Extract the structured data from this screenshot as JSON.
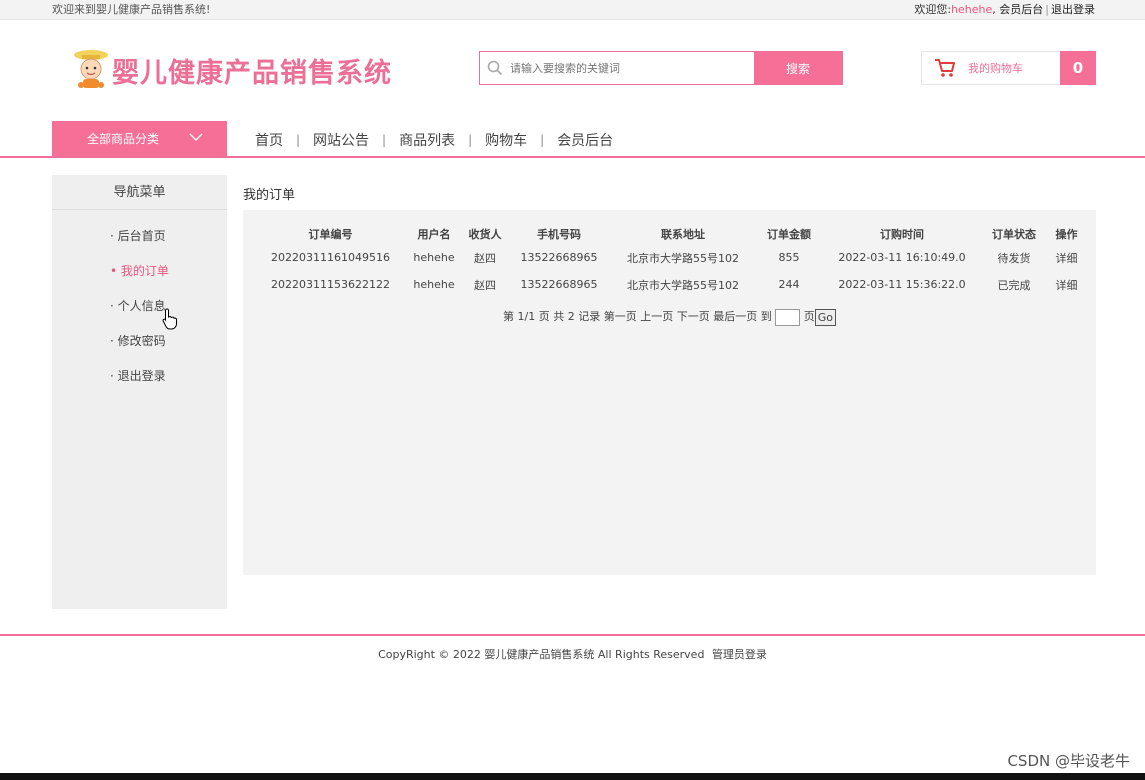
{
  "topbar": {
    "welcome": "欢迎来到婴儿健康产品销售系统!",
    "greeting": "欢迎您:",
    "username": "hehehe",
    "comma": ",",
    "member_link": "会员后台",
    "separator": "|",
    "logout_link": "退出登录"
  },
  "header": {
    "logo_text": "婴儿健康产品销售系统",
    "search_placeholder": "请输入要搜索的关键词",
    "search_button": "搜索",
    "cart_label": "我的购物车",
    "cart_count": "0"
  },
  "nav": {
    "category_button": "全部商品分类",
    "links": [
      "首页",
      "网站公告",
      "商品列表",
      "购物车",
      "会员后台"
    ],
    "separator": "|"
  },
  "sidebar": {
    "title": "导航菜单",
    "items": [
      "· 后台首页",
      "• 我的订单",
      "· 个人信息",
      "· 修改密码",
      "· 退出登录"
    ],
    "active_index": 1
  },
  "main": {
    "title": "我的订单",
    "columns": [
      "订单编号",
      "用户名",
      "收货人",
      "手机号码",
      "联系地址",
      "订单金额",
      "订购时间",
      "订单状态",
      "操作"
    ],
    "rows": [
      [
        "20220311161049516",
        "hehehe",
        "赵四",
        "13522668965",
        "北京市大学路55号102",
        "855",
        "2022-03-11 16:10:49.0",
        "待发货",
        "详细"
      ],
      [
        "20220311153622122",
        "hehehe",
        "赵四",
        "13522668965",
        "北京市大学路55号102",
        "244",
        "2022-03-11 15:36:22.0",
        "已完成",
        "详细"
      ]
    ],
    "pager": {
      "info": "第 1/1 页 共 2 记录",
      "first": "第一页",
      "prev": "上一页",
      "next": "下一页",
      "last": "最后一页",
      "goto_label": "到",
      "page_unit": "页",
      "go_button": "Go"
    }
  },
  "footer": {
    "copyright": "CopyRight © 2022 婴儿健康产品销售系统 All Rights Reserved",
    "admin_link": "管理员登录"
  },
  "watermark": "CSDN @毕设老牛",
  "colors": {
    "accent": "#f56f97",
    "accent_text": "#e8557f",
    "panel_bg": "#f3f3f3",
    "sidebar_bg": "#efefef"
  }
}
